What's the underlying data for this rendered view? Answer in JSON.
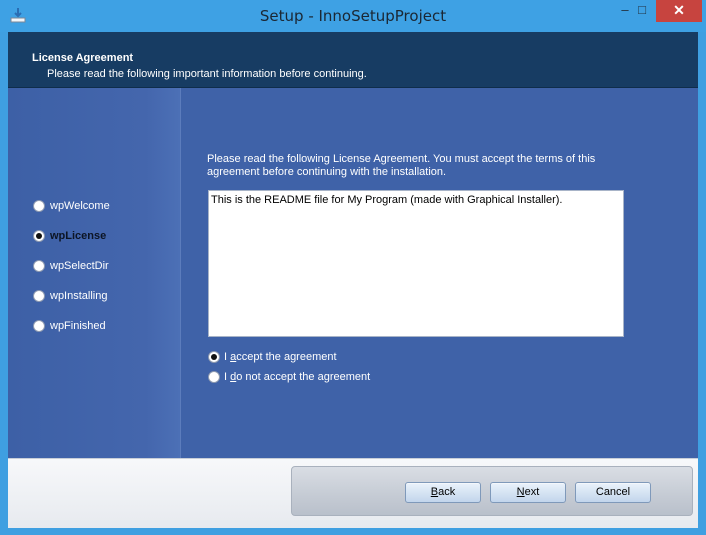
{
  "window": {
    "title": "Setup - InnoSetupProject",
    "minimize_glyph": "–",
    "maximize_glyph": "□",
    "close_glyph": "✕"
  },
  "header": {
    "title": "License Agreement",
    "subtitle": "Please read the following important information before continuing."
  },
  "sidebar": {
    "steps": [
      {
        "label": "wpWelcome"
      },
      {
        "label": "wpLicense"
      },
      {
        "label": "wpSelectDir"
      },
      {
        "label": "wpInstalling"
      },
      {
        "label": "wpFinished"
      }
    ],
    "active_index": 1
  },
  "content": {
    "intro_line1": "Please read the following License Agreement. You must accept the terms of this",
    "intro_line2": "agreement before continuing with the installation.",
    "license_text": "This is the README file for My Program (made with Graphical Installer).",
    "accept_prefix": "I ",
    "accept_underlined": "a",
    "accept_rest": "ccept the agreement",
    "decline_prefix": "I ",
    "decline_underlined": "d",
    "decline_rest": "o not accept the agreement",
    "selected_option": "accept"
  },
  "buttons": {
    "back_underlined": "B",
    "back_rest": "ack",
    "next_underlined": "N",
    "next_rest": "ext",
    "cancel": "Cancel"
  },
  "colors": {
    "titlebar": "#3ea1e4",
    "header": "#173c63",
    "body": "#3f62a8",
    "close": "#c7443f"
  }
}
